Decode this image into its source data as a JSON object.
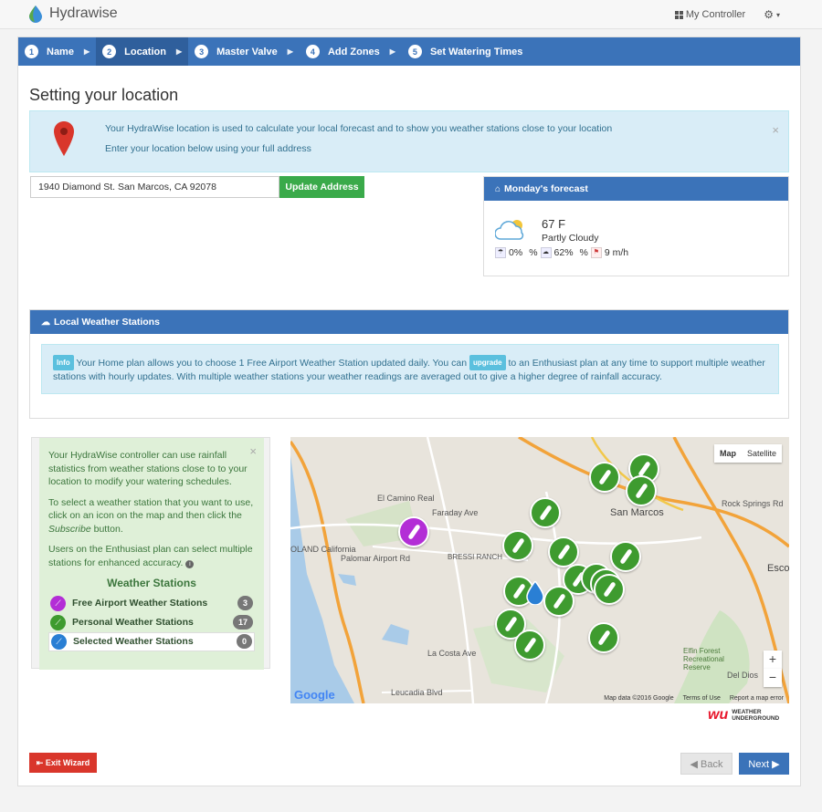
{
  "app": {
    "name": "Hydrawise"
  },
  "nav": {
    "controller_label": "My Controller",
    "settings_caret": "▾"
  },
  "wizard_steps": [
    {
      "num": "1",
      "label": "Name"
    },
    {
      "num": "2",
      "label": "Location"
    },
    {
      "num": "3",
      "label": "Master Valve"
    },
    {
      "num": "4",
      "label": "Add Zones"
    },
    {
      "num": "5",
      "label": "Set Watering Times"
    }
  ],
  "active_step": "2",
  "page": {
    "title": "Setting your location"
  },
  "location_alert": {
    "line1": "Your HydraWise location is used to calculate your local forecast and to show you weather stations close to your location",
    "line2": "Enter your location below using your full address",
    "close": "×"
  },
  "address": {
    "value": "1940 Diamond St. San Marcos, CA 92078",
    "button": "Update Address"
  },
  "forecast": {
    "title": "Monday's forecast",
    "temp": "67 F",
    "condition": "Partly Cloudy",
    "rain_chance": "0%",
    "sep1": "%",
    "humidity": "62%",
    "sep2": "%",
    "wind": "9 m/h"
  },
  "local_stations": {
    "title": "Local Weather Stations",
    "info_label": "Info",
    "text_a": "Your Home plan allows you to choose 1 Free Airport Weather Station updated daily. You can",
    "upgrade_label": "upgrade",
    "text_b": "to an Enthusiast plan at any time to support multiple weather stations with hourly updates. With multiple weather stations your weather readings are averaged out to give a higher degree of rainfall accuracy."
  },
  "station_help": {
    "p1": "Your HydraWise controller can use rainfall statistics from weather stations close to to your location to modify your watering schedules.",
    "p2a": "To select a weather station that you want to use, click on an icon on the map and then click the",
    "p2_em": "Subscribe",
    "p2b": "button.",
    "p3": "Users on the Enthusiast plan can select multiple stations for enhanced accuracy.",
    "close": "×",
    "legend_title": "Weather Stations",
    "legend": [
      {
        "label": "Free Airport Weather Stations",
        "count": "3",
        "color": "#b32ed6"
      },
      {
        "label": "Personal Weather Stations",
        "count": "17",
        "color": "#3e9b2f"
      },
      {
        "label": "Selected Weather Stations",
        "count": "0",
        "color": "#2a7fd4"
      }
    ]
  },
  "map": {
    "type_map": "Map",
    "type_satellite": "Satellite",
    "zoom_in": "+",
    "zoom_out": "−",
    "labels": {
      "san_marcos": "San Marcos",
      "carlsbad": "OLAND California",
      "palomar": "Palomar Airport Rd",
      "faraday": "Faraday Ave",
      "el_camino": "El Camino Real",
      "bressi": "BRESSI RANCH",
      "elfin": "Elfin Forest Recreational Reserve",
      "del_dios": "Del Dios",
      "escondido": "Esco",
      "rock_springs": "Rock Springs Rd",
      "la_costa": "La Costa Ave",
      "leucadia": "Leucadia Blvd"
    },
    "footer_data": "Map data ©2016 Google",
    "footer_terms": "Terms of Use",
    "footer_report": "Report a map error",
    "google": "Google"
  },
  "weather_underground": {
    "logo": "wu",
    "line1": "WEATHER",
    "line2": "UNDERGROUND"
  },
  "buttons": {
    "exit": "Exit Wizard",
    "back": "Back",
    "next": "Next"
  },
  "colors": {
    "primary": "#3b73b9",
    "success": "#3aaa4a",
    "danger": "#d9362b",
    "airport": "#b32ed6",
    "personal": "#3e9b2f",
    "selected": "#2a7fd4"
  }
}
